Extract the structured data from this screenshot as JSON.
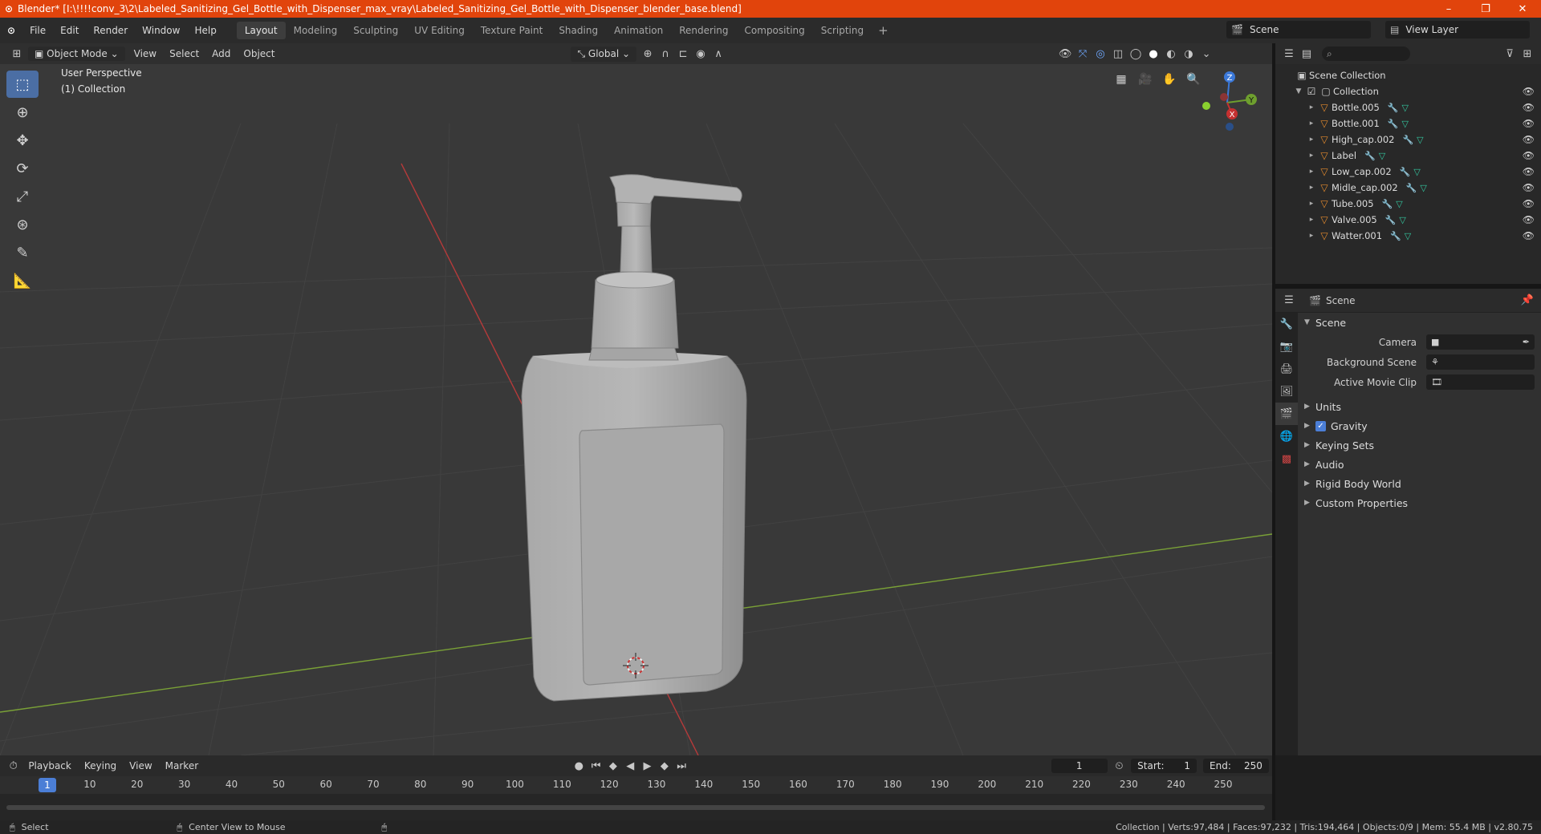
{
  "window": {
    "logo": "Blender",
    "title": "Blender* [I:\\!!!!conv_3\\2\\Labeled_Sanitizing_Gel_Bottle_with_Dispenser_max_vray\\Labeled_Sanitizing_Gel_Bottle_with_Dispenser_blender_base.blend]",
    "minimize": "–",
    "maximize": "❐",
    "close": "✕"
  },
  "menu": [
    "File",
    "Edit",
    "Render",
    "Window",
    "Help"
  ],
  "workspaces": [
    "Layout",
    "Modeling",
    "Sculpting",
    "UV Editing",
    "Texture Paint",
    "Shading",
    "Animation",
    "Rendering",
    "Compositing",
    "Scripting"
  ],
  "workspace_active": "Layout",
  "add_workspace": "+",
  "scene_selector": "Scene",
  "view_layer_selector": "View Layer",
  "viewport_header": {
    "mode": "Object Mode",
    "menus": [
      "View",
      "Select",
      "Add",
      "Object"
    ],
    "transform_orientation": "Global"
  },
  "viewport": {
    "perspective_label": "User Perspective",
    "collection_label": "(1) Collection",
    "gizmo_axes": {
      "x": "X",
      "y": "Y",
      "z": "Z"
    }
  },
  "tools": [
    "select-box",
    "cursor",
    "move",
    "rotate",
    "scale",
    "transform",
    "annotate",
    "measure"
  ],
  "outliner": {
    "root": "Scene Collection",
    "collection": "Collection",
    "objects": [
      "Bottle.005",
      "Bottle.001",
      "High_cap.002",
      "Label",
      "Low_cap.002",
      "Midle_cap.002",
      "Tube.005",
      "Valve.005",
      "Watter.001"
    ]
  },
  "properties": {
    "header": "Scene",
    "section": "Scene",
    "fields": [
      {
        "label": "Camera",
        "value": ""
      },
      {
        "label": "Background Scene",
        "value": ""
      },
      {
        "label": "Active Movie Clip",
        "value": ""
      }
    ],
    "panels": [
      "Units",
      "Gravity",
      "Keying Sets",
      "Audio",
      "Rigid Body World",
      "Custom Properties"
    ],
    "gravity_enabled": true
  },
  "timeline": {
    "menus": [
      "Playback",
      "Keying",
      "View",
      "Marker"
    ],
    "current_frame": "1",
    "start_label": "Start:",
    "start": "1",
    "end_label": "End:",
    "end": "250",
    "ruler": [
      "1",
      "10",
      "20",
      "30",
      "40",
      "50",
      "60",
      "70",
      "80",
      "90",
      "100",
      "110",
      "120",
      "130",
      "140",
      "150",
      "160",
      "170",
      "180",
      "190",
      "200",
      "210",
      "220",
      "230",
      "240",
      "250"
    ]
  },
  "status_bar": {
    "left_action": "Select",
    "middle_action": "Center View to Mouse",
    "stats": "Collection | Verts:97,484 | Faces:97,232 | Tris:194,464 | Objects:0/9 | Mem: 55.4 MB | v2.80.75"
  },
  "colors": {
    "title_bar": "#e1440c",
    "viewport_bg": "#393939",
    "x_axis": "#c0393b",
    "y_axis": "#7fa63a",
    "active_tool": "#4b6ea4",
    "mesh_icon": "#34c7a0",
    "object_icon": "#e38a2e"
  }
}
